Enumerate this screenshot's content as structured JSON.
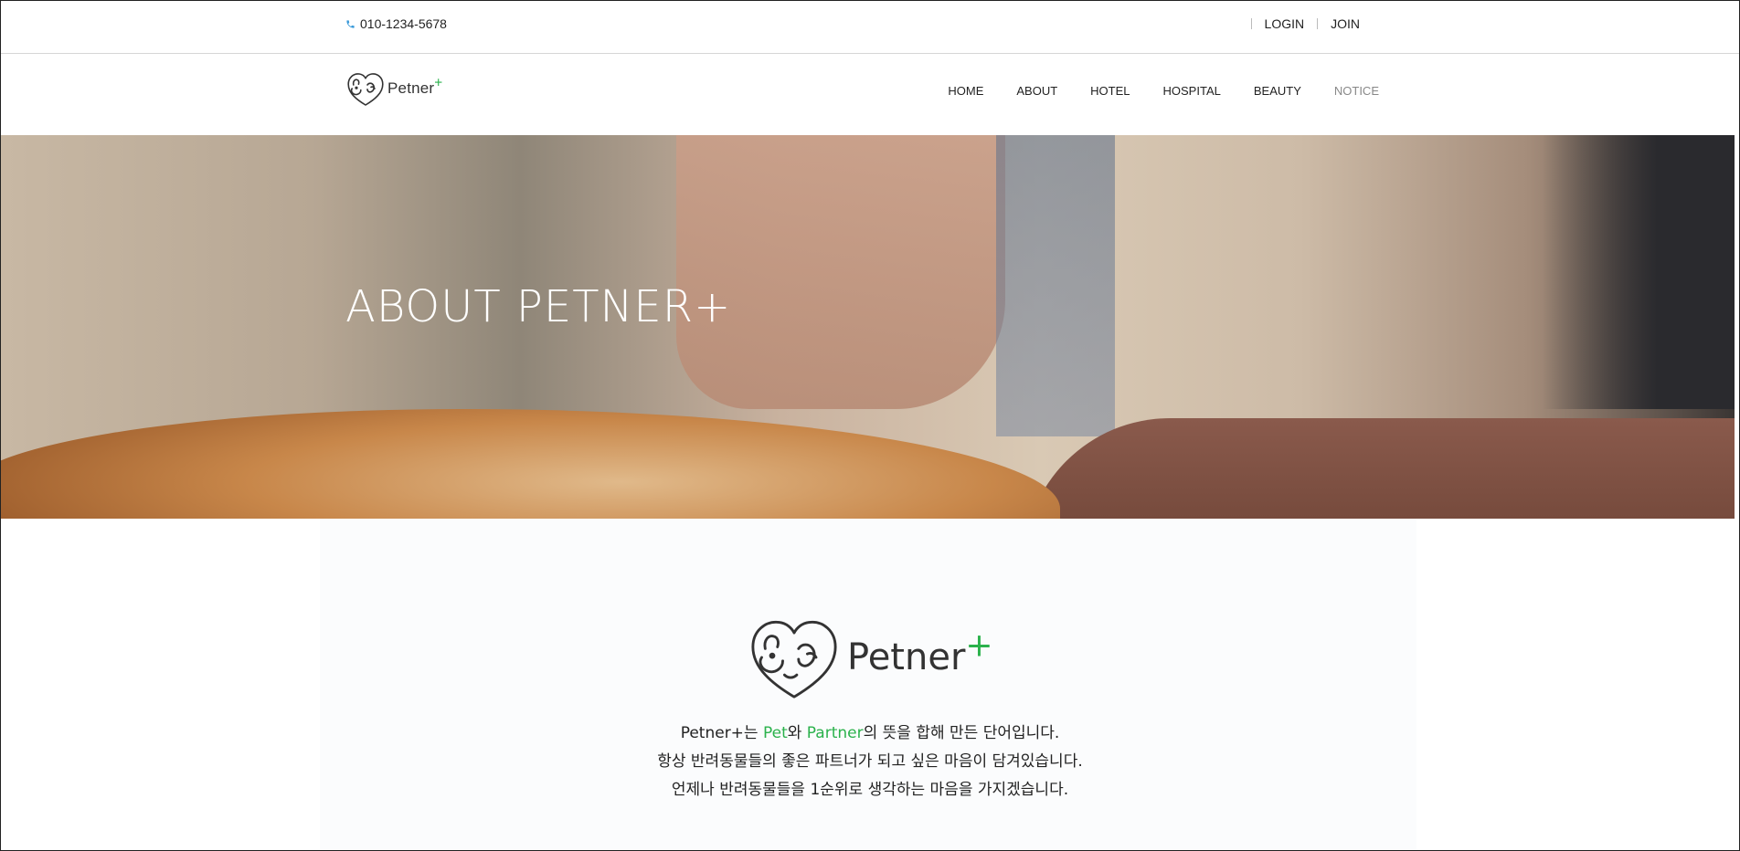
{
  "topbar": {
    "phone": "010-1234-5678",
    "login": "LOGIN",
    "join": "JOIN"
  },
  "brand": {
    "name": "Petner",
    "plus": "+",
    "accent": "#2bb24c"
  },
  "nav": {
    "items": [
      "HOME",
      "ABOUT",
      "HOTEL",
      "HOSPITAL",
      "BEAUTY",
      "NOTICE"
    ]
  },
  "hero": {
    "title": "ABOUT PETNER+"
  },
  "about": {
    "line1": {
      "a": "Petner+는 ",
      "pet": "Pet",
      "b": "와 ",
      "partner": "Partner",
      "c": "의 뜻을 합해 만든 단어입니다."
    },
    "line2": "항상 반려동물들의 좋은 파트너가 되고 싶은 마음이 담겨있습니다.",
    "line3": "언제나 반려동물들을 1순위로 생각하는 마음을 가지겠습니다."
  },
  "icons": {
    "phone": "phone-icon",
    "logo": "pet-heart-logo-icon"
  }
}
